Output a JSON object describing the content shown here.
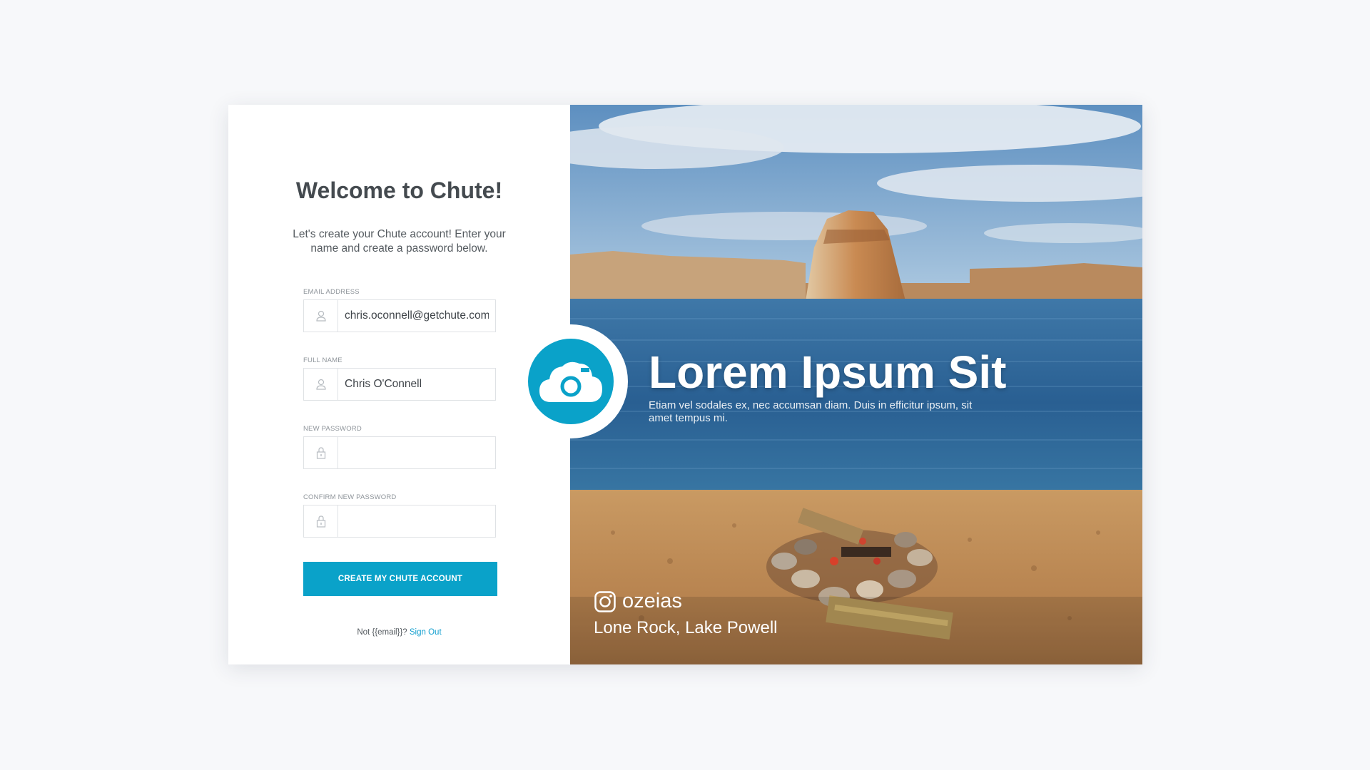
{
  "form": {
    "title": "Welcome to Chute!",
    "subtitle": "Let's create your Chute account! Enter your name and create a password below.",
    "fields": [
      {
        "label": "Email Address",
        "value": "chris.oconnell@getchute.com",
        "icon": "user-icon"
      },
      {
        "label": "Full Name",
        "value": "Chris O'Connell",
        "icon": "user-icon"
      },
      {
        "label": "New Password",
        "value": "",
        "icon": "lock-icon"
      },
      {
        "label": "Confirm New Password",
        "value": "",
        "icon": "lock-icon"
      }
    ],
    "submit_label": "Create My Chute Account",
    "footer_prefix": "Not {{email}}?",
    "footer_link": "Sign Out"
  },
  "hero": {
    "title": "Lorem Ipsum Sit",
    "text": "Etiam vel sodales ex, nec accumsan diam. Duis in efficitur ipsum, sit amet tempus mi.",
    "instagram_handle": "ozeias",
    "location": "Lone Rock, Lake Powell"
  },
  "colors": {
    "accent": "#0aa2c9",
    "background": "#f7f8fa",
    "title_text": "#444a4f"
  }
}
